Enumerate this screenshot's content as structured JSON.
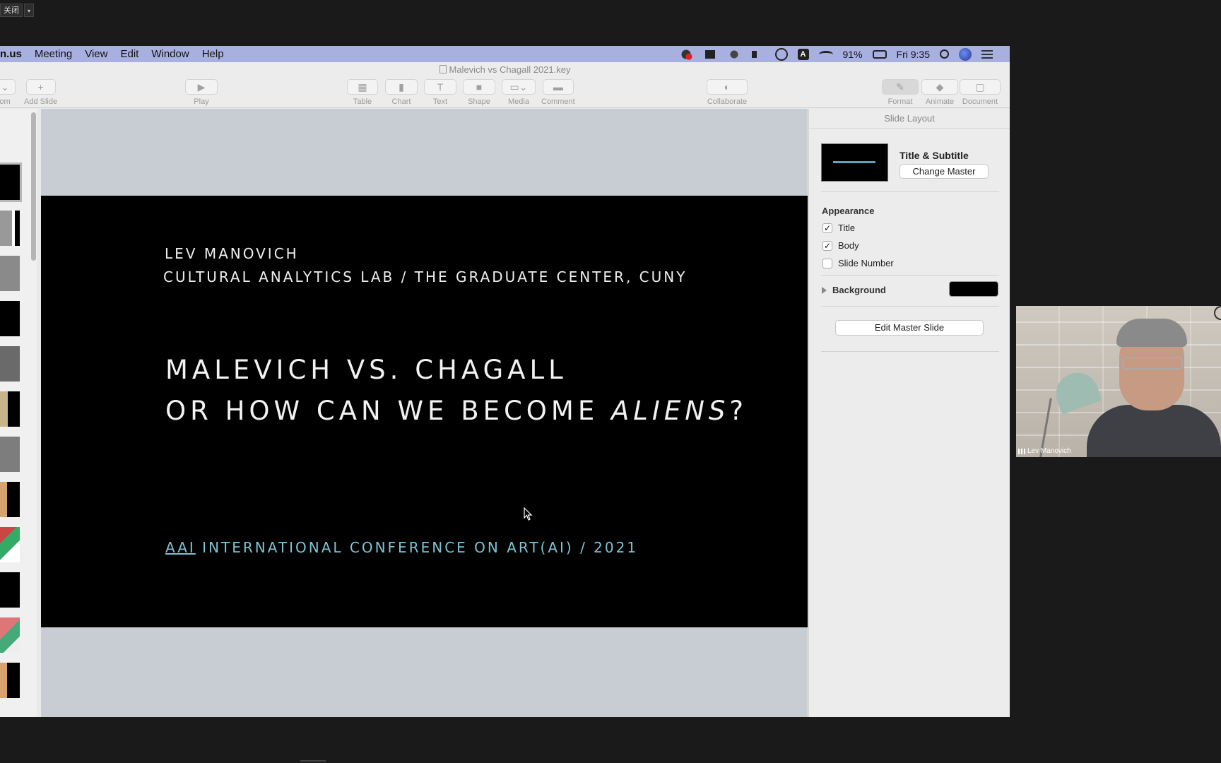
{
  "zoom_control": {
    "close_label": "关闭",
    "caret": "▾"
  },
  "menubar": {
    "app_name": "n.us",
    "menus": [
      "Meeting",
      "View",
      "Edit",
      "Window",
      "Help"
    ],
    "battery": "91%",
    "clock": "Fri 9:35",
    "input_source": "A"
  },
  "window": {
    "document_title": "Malevich vs Chagall 2021.key"
  },
  "toolbar": {
    "zoom_label": "om",
    "add_slide_label": "Add Slide",
    "play_label": "Play",
    "table_label": "Table",
    "chart_label": "Chart",
    "text_label": "Text",
    "shape_label": "Shape",
    "media_label": "Media",
    "comment_label": "Comment",
    "collaborate_label": "Collaborate",
    "format_label": "Format",
    "animate_label": "Animate",
    "document_label": "Document"
  },
  "slide": {
    "author": "LEV MANOVICH",
    "affiliation": "CULTURAL ANALYTICS LAB / THE GRADUATE CENTER, CUNY",
    "title_line1": "MALEVICH VS. CHAGALL",
    "title_line2_pre": "OR HOW CAN WE BECOME ",
    "title_line2_em": "ALIENS",
    "title_line2_post": "?",
    "conference_abbr": "AAI",
    "conference_rest": " INTERNATIONAL CONFERENCE ON ART(AI) / 2021"
  },
  "inspector": {
    "header": "Slide Layout",
    "layout_name": "Title & Subtitle",
    "change_master_label": "Change Master",
    "appearance_label": "Appearance",
    "checkboxes": [
      {
        "label": "Title",
        "checked": true
      },
      {
        "label": "Body",
        "checked": true
      },
      {
        "label": "Slide Number",
        "checked": false
      }
    ],
    "background_label": "Background",
    "background_color": "#000000",
    "edit_master_label": "Edit Master Slide"
  },
  "video": {
    "participant_name": "Lev Manovich"
  },
  "colors": {
    "menubar": "#a8b0df",
    "slide_bg": "#000000",
    "conference_text": "#7cc4d6",
    "canvas_bg": "#c8cdd3"
  }
}
